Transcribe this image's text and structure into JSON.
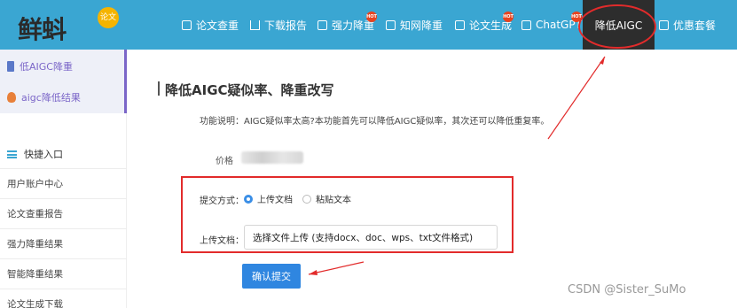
{
  "header": {
    "logo_text": "鲜蚪",
    "logo_badge": "论文",
    "nav_items": [
      {
        "label": "论文查重",
        "icon": "document-icon",
        "hot": false
      },
      {
        "label": "下载报告",
        "icon": "download-icon",
        "hot": false
      },
      {
        "label": "强力降重",
        "icon": "image-icon",
        "hot": true
      },
      {
        "label": "知网降重",
        "icon": "image-icon",
        "hot": false
      },
      {
        "label": "论文生成",
        "icon": "image-icon",
        "hot": true
      },
      {
        "label": "ChatGPT",
        "icon": "chat-icon",
        "hot": true
      },
      {
        "label": "降低AIGC",
        "icon": "",
        "hot": false,
        "active": true
      },
      {
        "label": "优惠套餐",
        "icon": "chat-icon",
        "hot": false
      }
    ],
    "hot_label": "HOT"
  },
  "sidebar": {
    "top_links": [
      {
        "label": "低AIGC降重",
        "icon": "document-icon"
      },
      {
        "label": "aigc降低结果",
        "icon": "flame-icon"
      }
    ],
    "quick_entry": "快捷入口",
    "rows": [
      "用户账户中心",
      "论文查重报告",
      "强力降重结果",
      "智能降重结果",
      "论文生成下载"
    ]
  },
  "main": {
    "title": "降低AIGC疑似率、降重改写",
    "description": "功能说明：AIGC疑似率太高?本功能首先可以降低AIGC疑似率，其次还可以降低重复率。",
    "price_label": "价格",
    "submit_mode_label": "提交方式：",
    "options": [
      "上传文档",
      "粘贴文本"
    ],
    "selected_option": "上传文档",
    "upload_label": "上传文档：",
    "file_button": "选择文件上传   (支持docx、doc、wps、txt文件格式)",
    "submit_button": "确认提交"
  },
  "watermark": "CSDN @Sister_SuMo",
  "colors": {
    "nav_bg": "#3aa6d2",
    "accent": "#2f86e0",
    "annotation": "#e22b2b",
    "sidebar_active": "#7b66c8"
  }
}
